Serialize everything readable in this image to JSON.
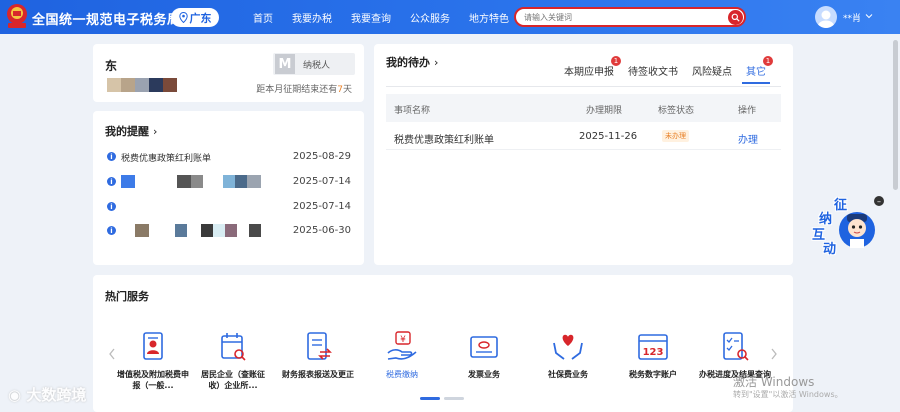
{
  "header": {
    "title": "全国统一规范电子税务局",
    "region": "广东",
    "nav": [
      "首页",
      "我要办税",
      "我要查询",
      "公众服务",
      "地方特色"
    ],
    "search_placeholder": "请输入关键词",
    "username": "**肖"
  },
  "profile": {
    "company_name_prefix": "东",
    "badge_letter": "M",
    "taxpayer_type": "纳税人",
    "deadline_prefix": "距本月征期结束还有",
    "deadline_days": "7",
    "deadline_suffix": "天"
  },
  "reminders": {
    "title": "我的提醒",
    "items": [
      {
        "text": "税费优惠政策红利账单",
        "date": "2025-08-29"
      },
      {
        "text": "",
        "date": "2025-07-14"
      },
      {
        "text": "",
        "date": "2025-07-14"
      },
      {
        "text": "",
        "date": "2025-06-30"
      }
    ]
  },
  "todo": {
    "title": "我的待办",
    "tabs": [
      {
        "label": "本期应申报",
        "badge": "1"
      },
      {
        "label": "待签收文书",
        "badge": ""
      },
      {
        "label": "风险疑点",
        "badge": ""
      },
      {
        "label": "其它",
        "badge": "1"
      }
    ],
    "columns": [
      "事项名称",
      "办理期限",
      "标签状态",
      "操作"
    ],
    "rows": [
      {
        "name": "税费优惠政策红利账单",
        "deadline": "2025-11-26",
        "status": "未办理",
        "action": "办理"
      }
    ]
  },
  "hot_services": {
    "title": "热门服务",
    "items": [
      {
        "label": "增值税及附加税费申报（一般...",
        "icon": "document-person-icon"
      },
      {
        "label": "居民企业（查账征收）企业所...",
        "icon": "calendar-search-icon"
      },
      {
        "label": "财务报表报送及更正",
        "icon": "report-exchange-icon"
      },
      {
        "label": "税费缴纳",
        "icon": "hand-yen-icon"
      },
      {
        "label": "发票业务",
        "icon": "invoice-icon"
      },
      {
        "label": "社保费业务",
        "icon": "hands-heart-icon"
      },
      {
        "label": "税务数字账户",
        "icon": "digital-account-icon"
      },
      {
        "label": "办税进度及结果查询",
        "icon": "checklist-search-icon"
      }
    ]
  },
  "assistant": {
    "chars": [
      "征",
      "纳",
      "互",
      "动"
    ]
  },
  "watermark": {
    "brand": "大数跨境",
    "win_title": "激活 Windows",
    "win_sub": "转到\"设置\"以激活 Windows。"
  },
  "colors": {
    "primary": "#2f6be0",
    "header": "#1f63e0",
    "alert": "#d8262b",
    "pending": "#e8822a"
  }
}
